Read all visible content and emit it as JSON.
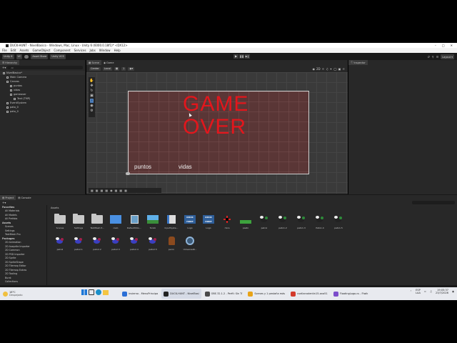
{
  "window": {
    "title": "DUCK-HUNT - NivelBasico - Windows, Mac, Linux - Unity 6 (6000.0.18f1)* <DX12>"
  },
  "menu": [
    "File",
    "Edit",
    "Assets",
    "GameObject",
    "Component",
    "Services",
    "Jobs",
    "Window",
    "Help"
  ],
  "toolbar": {
    "unity_version": "Unity 6",
    "vc_label": "VC",
    "asset_store": "Asset Store",
    "unity_vcs": "Unity VCS",
    "layout": "Layout"
  },
  "hierarchy": {
    "tab": "Hierarchy",
    "search_placeholder": "All",
    "items": [
      {
        "label": "NivelBasico*",
        "depth": 0
      },
      {
        "label": "Main Camera",
        "depth": 1
      },
      {
        "label": "Canvas",
        "depth": 1
      },
      {
        "label": "puntos",
        "depth": 2
      },
      {
        "label": "vidas",
        "depth": 2
      },
      {
        "label": "gameover",
        "depth": 2
      },
      {
        "label": "Text (TMP)",
        "depth": 3
      },
      {
        "label": "EventSystem",
        "depth": 1
      },
      {
        "label": "pato_0",
        "depth": 1
      },
      {
        "label": "pato_0",
        "depth": 1
      }
    ]
  },
  "scene": {
    "tabs": [
      "Scene",
      "Game"
    ],
    "center_label": "Center",
    "local_label": "Local",
    "game_over_line1": "GAME",
    "game_over_line2": "OVER",
    "puntos_label": "puntos",
    "vidas_label": "vidas"
  },
  "inspector": {
    "tab": "Inspector"
  },
  "project": {
    "tabs": [
      "Project",
      "Console"
    ],
    "breadcrumb": "Assets",
    "tree": [
      {
        "label": "Favorites",
        "depth": 0
      },
      {
        "label": "All Materials",
        "depth": 1
      },
      {
        "label": "All Models",
        "depth": 1
      },
      {
        "label": "All Prefabs",
        "depth": 1
      },
      {
        "label": "Assets",
        "depth": 0
      },
      {
        "label": "Scenes",
        "depth": 1
      },
      {
        "label": "Settings",
        "depth": 1
      },
      {
        "label": "TextMesh Pro",
        "depth": 1
      },
      {
        "label": "Packages",
        "depth": 0
      },
      {
        "label": "2D Animation",
        "depth": 1
      },
      {
        "label": "2D Aseprite Importer",
        "depth": 1
      },
      {
        "label": "2D Common",
        "depth": 1
      },
      {
        "label": "2D PSD Importer",
        "depth": 1
      },
      {
        "label": "2D Sprite",
        "depth": 1
      },
      {
        "label": "2D SpriteShape",
        "depth": 1
      },
      {
        "label": "2D Tilemap Editor",
        "depth": 1
      },
      {
        "label": "2D Tilemap Extras",
        "depth": 1
      },
      {
        "label": "2D Tooling",
        "depth": 1
      },
      {
        "label": "Burst",
        "depth": 1
      },
      {
        "label": "Collections",
        "depth": 1
      }
    ],
    "assets_row1": [
      {
        "label": "Scenes",
        "kind": "folder"
      },
      {
        "label": "Settings",
        "kind": "folder"
      },
      {
        "label": "TextMesh P...",
        "kind": "folder"
      },
      {
        "label": "cielo",
        "kind": "sky"
      },
      {
        "label": "DefaultVolu...",
        "kind": "cube"
      },
      {
        "label": "fondo",
        "kind": "grass"
      },
      {
        "label": "InputSyste...",
        "kind": "book"
      },
      {
        "label": "Logo",
        "kind": "logo"
      },
      {
        "label": "Logo",
        "kind": "logo"
      },
      {
        "label": "mira",
        "kind": "cross"
      },
      {
        "label": "pasto",
        "kind": "grass2"
      },
      {
        "label": "pato1",
        "kind": "duckb"
      },
      {
        "label": "pato1.2",
        "kind": "duckb"
      },
      {
        "label": "pato1.3",
        "kind": "duckb"
      },
      {
        "label": "Pato1.4",
        "kind": "duckb"
      },
      {
        "label": "pato1.5",
        "kind": "duckb"
      }
    ],
    "assets_row2": [
      {
        "label": "pato2",
        "kind": "duckp"
      },
      {
        "label": "pato2.1",
        "kind": "duckp"
      },
      {
        "label": "pato2.2",
        "kind": "duckp"
      },
      {
        "label": "pato2.3",
        "kind": "duckp"
      },
      {
        "label": "pato2.4",
        "kind": "duckp"
      },
      {
        "label": "pato2.5",
        "kind": "duckp"
      },
      {
        "label": "perro",
        "kind": "dog"
      },
      {
        "label": "UniversalR...",
        "kind": "gear"
      }
    ]
  },
  "taskbar": {
    "weather_temp": "18°C",
    "weather_desc": "Despejado",
    "items": [
      {
        "label": "invierno - MenuPrincipa",
        "color": "#2b6fd6"
      },
      {
        "label": "DUCK-HUNT - NivelBasi",
        "color": "#222222"
      },
      {
        "label": "OBS 32.1.2 - Perfil: Sin Tí",
        "color": "#4a4a4a"
      },
      {
        "label": "Scenes y 1 pestaña más",
        "color": "#e8a317"
      },
      {
        "label": "cuellarvalentin15-ana51",
        "color": "#d33a2c"
      },
      {
        "label": "FloatingLogo.cs - Flwik",
        "color": "#7c4dcb"
      }
    ],
    "lang": "ESP",
    "lang2": "LAA",
    "time": "19:05:37",
    "date": "23/7/2026"
  },
  "colors": {
    "game_over": "#e3161c",
    "canvas_fill": "#5a3636",
    "accent_blue": "#3a7bd5"
  }
}
